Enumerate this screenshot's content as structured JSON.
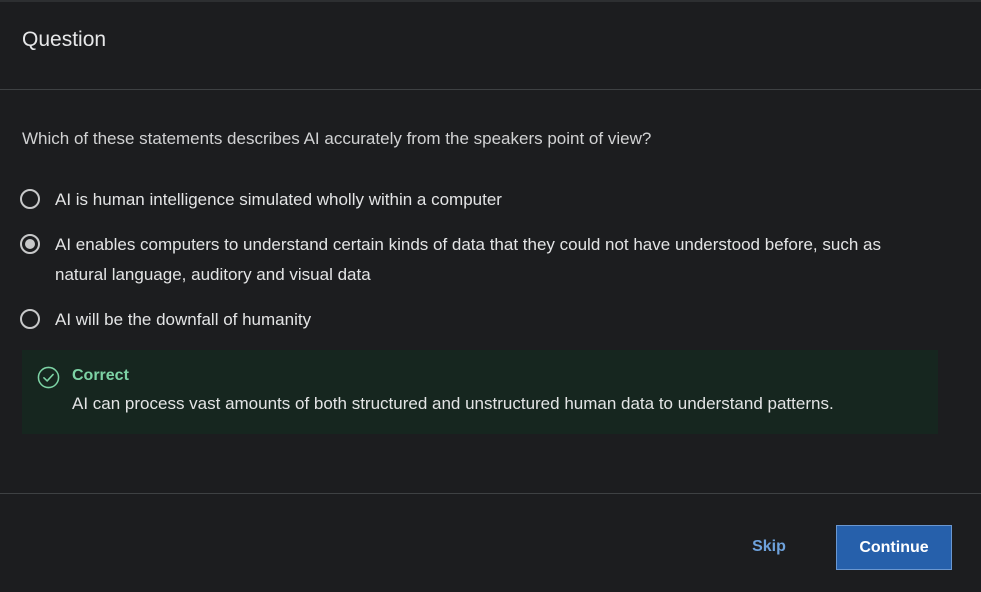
{
  "header": {
    "title": "Question"
  },
  "quiz": {
    "question": "Which of these statements describes AI accurately from the speakers point of view?",
    "options": [
      {
        "label": "AI is human intelligence simulated wholly within a computer",
        "selected": false
      },
      {
        "label": "AI enables computers to understand certain kinds of data that they could not have understood before, such as natural language, auditory and visual data",
        "selected": true
      },
      {
        "label": "AI will be the downfall of humanity",
        "selected": false
      }
    ]
  },
  "feedback": {
    "icon": "check-circle-icon",
    "title": "Correct",
    "message": "AI can process vast amounts of both structured and unstructured human data to understand patterns.",
    "color": "#7dd3a5",
    "background": "#16261f"
  },
  "footer": {
    "skip_label": "Skip",
    "continue_label": "Continue",
    "accent_color": "#2660ab"
  }
}
